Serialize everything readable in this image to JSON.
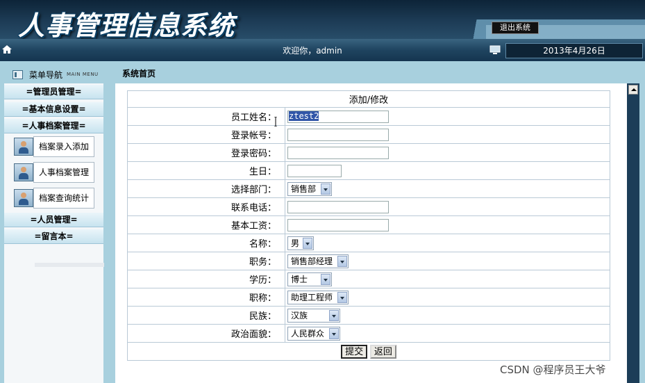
{
  "header": {
    "title": "人事管理信息系统",
    "logout_label": "退出系统"
  },
  "statusbar": {
    "welcome": "欢迎你，admin",
    "date": "2013年4月26日"
  },
  "sidebar": {
    "title": "菜单导航",
    "subtitle": "MAIN MENU",
    "groups": [
      {
        "label": "=管理员管理="
      },
      {
        "label": "=基本信息设置="
      },
      {
        "label": "=人事档案管理="
      },
      {
        "label": "=人员管理="
      },
      {
        "label": "=留言本="
      }
    ],
    "items": [
      {
        "label": "档案录入添加"
      },
      {
        "label": "人事档案管理"
      },
      {
        "label": "档案查询统计"
      }
    ]
  },
  "main": {
    "breadcrumb": "系统首页",
    "form": {
      "heading": "添加/修改",
      "fields": [
        {
          "label": "员工姓名：",
          "value": "ztest2"
        },
        {
          "label": "登录帐号：",
          "value": ""
        },
        {
          "label": "登录密码：",
          "value": ""
        },
        {
          "label": "生日：",
          "value": ""
        },
        {
          "label": "选择部门：",
          "value": "销售部"
        },
        {
          "label": "联系电话：",
          "value": ""
        },
        {
          "label": "基本工资：",
          "value": ""
        },
        {
          "label": "名称：",
          "value": "男"
        },
        {
          "label": "职务：",
          "value": "销售部经理"
        },
        {
          "label": "学历：",
          "value": "博士"
        },
        {
          "label": "职称：",
          "value": "助理工程师"
        },
        {
          "label": "民族：",
          "value": "汉族"
        },
        {
          "label": "政治面貌：",
          "value": "人民群众"
        }
      ],
      "submit_label": "提交",
      "back_label": "返回"
    }
  },
  "watermark": "CSDN @程序员王大爷"
}
